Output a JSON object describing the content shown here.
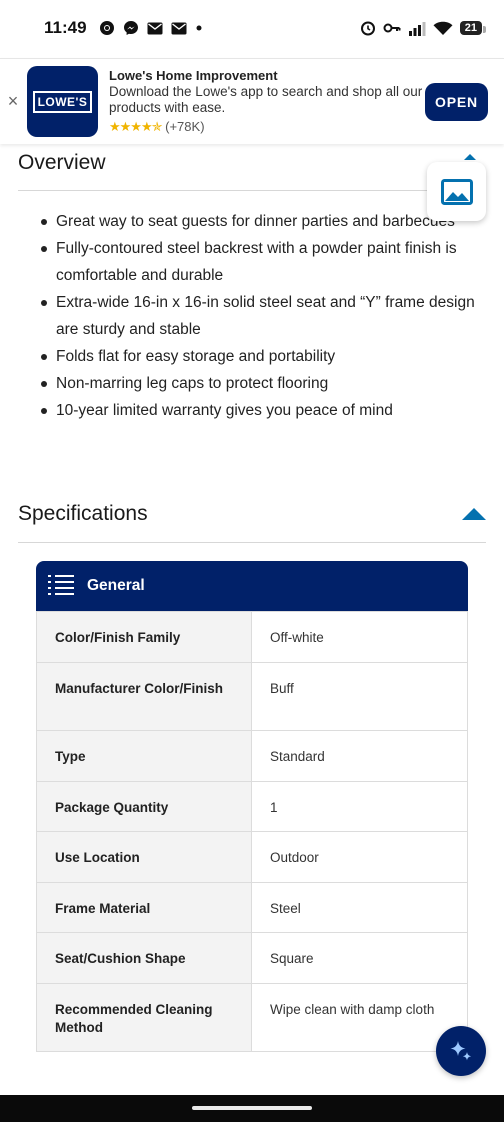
{
  "status_bar": {
    "time": "11:49",
    "battery": "21",
    "left_icons": [
      "chrome-icon",
      "messenger-icon",
      "mail-icon",
      "mail-icon",
      "dot-icon"
    ],
    "right_icons": [
      "alarm-icon",
      "vpn-key-icon",
      "signal-icon",
      "wifi-icon",
      "battery-icon"
    ]
  },
  "app_banner": {
    "logo_text": "LOWE'S",
    "title": "Lowe's Home Improvement",
    "description": "Download the Lowe's app to search and shop all our products with ease.",
    "stars": "★★★★✯",
    "rating_count": "(+78K)",
    "open_label": "OPEN",
    "close_glyph": "×"
  },
  "overview": {
    "title": "Overview",
    "bullets": [
      "Great way to seat guests for dinner parties and barbecues",
      "Fully-contoured steel backrest with a powder paint finish is comfortable and durable",
      "Extra-wide 16-in x 16-in solid steel seat and “Y” frame design are sturdy and stable",
      "Folds flat for easy storage and portability",
      "Non-marring leg caps to protect flooring",
      "10-year limited warranty gives you peace of mind"
    ]
  },
  "specifications": {
    "title": "Specifications",
    "card_title": "General",
    "rows": [
      {
        "label": "Color/Finish Family",
        "value": "Off-white"
      },
      {
        "label": "Manufacturer Color/Finish",
        "value": "Buff"
      },
      {
        "label": "Type",
        "value": "Standard"
      },
      {
        "label": "Package Quantity",
        "value": "1"
      },
      {
        "label": "Use Location",
        "value": "Outdoor"
      },
      {
        "label": "Frame Material",
        "value": "Steel"
      },
      {
        "label": "Seat/Cushion Shape",
        "value": "Square"
      },
      {
        "label": "Recommended Cleaning Method",
        "value": "Wipe clean with damp cloth"
      }
    ]
  },
  "colors": {
    "brand_navy": "#012169",
    "accent_blue": "#0471af",
    "star_gold": "#f0b400"
  }
}
